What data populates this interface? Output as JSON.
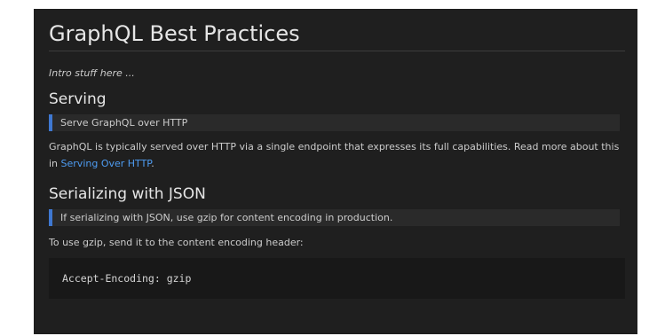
{
  "document": {
    "title": "GraphQL Best Practices",
    "intro": "Intro stuff here ...",
    "sections": [
      {
        "heading": "Serving",
        "callout": "Serve GraphQL over HTTP",
        "body_before_link": "GraphQL is typically served over HTTP via a single endpoint that expresses its full capabilities. Read more about this in ",
        "link_text": "Serving Over HTTP",
        "body_after_link": "."
      },
      {
        "heading": "Serializing with JSON",
        "callout": "If serializing with JSON, use gzip for content encoding in production.",
        "body": "To use gzip, send it to the content encoding header:",
        "code": "Accept-Encoding: gzip"
      }
    ]
  },
  "colors": {
    "background": "#1f1f1f",
    "text": "#cccccc",
    "heading": "#e6e6e6",
    "link": "#4e9cf2",
    "callout_bar": "#3f78d1",
    "callout_bg": "#2a2a2a",
    "code_bg": "#181818"
  }
}
